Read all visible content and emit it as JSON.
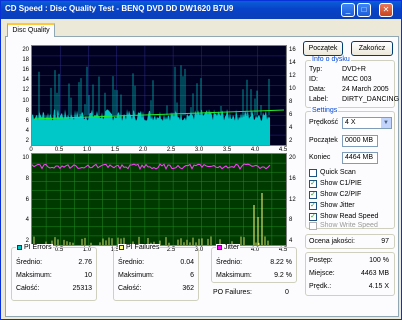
{
  "window": {
    "title": "CD Speed : Disc Quality Test - BENQ    DVD DD DW1620    B7U9",
    "minimize": "_",
    "maximize": "□",
    "close": "✕"
  },
  "tab": {
    "label": "Disc Quality"
  },
  "chart1": {
    "left_ticks": [
      "20",
      "18",
      "16",
      "14",
      "12",
      "10",
      "8",
      "6",
      "4",
      "2"
    ],
    "right_ticks": [
      "16",
      "14",
      "12",
      "10",
      "8",
      "6",
      "4",
      "2"
    ],
    "x_ticks": [
      "0",
      "0.5",
      "1.0",
      "1.5",
      "2.0",
      "2.5",
      "3.0",
      "3.5",
      "4.0",
      "4.5"
    ]
  },
  "chart2": {
    "left_ticks": [
      "10",
      "8",
      "6",
      "4",
      "2"
    ],
    "right_ticks": [
      "20",
      "16",
      "12",
      "8",
      "4"
    ],
    "x_ticks": [
      "0",
      "0.5",
      "1.0",
      "1.5",
      "2.0",
      "2.5",
      "3.0",
      "3.5",
      "4.0",
      "4.5"
    ]
  },
  "chart_data": [
    {
      "type": "area",
      "series": [
        {
          "name": "PI Errors",
          "color": "#00c8c8"
        },
        {
          "name": "PI Errors max",
          "color": "#00ff00"
        },
        {
          "name": "Read Speed",
          "color": "#00aa00"
        }
      ],
      "xlim": [
        0,
        4.5
      ],
      "ylim_left": [
        0,
        20
      ],
      "ylim_right": [
        0,
        16
      ],
      "grid": true
    },
    {
      "type": "bar",
      "series": [
        {
          "name": "PI Failures",
          "color": "#ffff80"
        },
        {
          "name": "Jitter",
          "color": "#ff00ff"
        }
      ],
      "xlim": [
        0,
        4.5
      ],
      "ylim_left": [
        0,
        10
      ],
      "ylim_right": [
        0,
        20
      ],
      "grid": true
    }
  ],
  "buttons": {
    "start": "Początek",
    "end": "Zakończ"
  },
  "info": {
    "title": "Info o dysku",
    "rows": [
      {
        "k": "Typ:",
        "v": "DVD+R"
      },
      {
        "k": "ID:",
        "v": "MCC 003"
      },
      {
        "k": "Data:",
        "v": "24 March 2005"
      },
      {
        "k": "Label:",
        "v": "DIRTY_DANCING"
      }
    ]
  },
  "settings": {
    "title": "Settings",
    "speed_label": "Prędkość",
    "speed_value": "4 X",
    "start_label": "Początek",
    "start_value": "0000 MB",
    "end_label": "Koniec",
    "end_value": "4464 MB",
    "checks": [
      {
        "label": "Quick Scan",
        "checked": false
      },
      {
        "label": "Show C1/PIE",
        "checked": true
      },
      {
        "label": "Show C2/PIF",
        "checked": true
      },
      {
        "label": "Show Jitter",
        "checked": true
      },
      {
        "label": "Show Read Speed",
        "checked": true
      },
      {
        "label": "Show Write Speed",
        "checked": false
      }
    ]
  },
  "score": {
    "label": "Ocena jakości:",
    "value": "97"
  },
  "progress": {
    "rows": [
      {
        "k": "Postęp:",
        "v": "100 %"
      },
      {
        "k": "Miejsce:",
        "v": "4463 MB"
      },
      {
        "k": "Prędk.:",
        "v": "4.15 X"
      }
    ]
  },
  "pi_errors": {
    "title": "PI Errors",
    "color": "#00c8c8",
    "rows": [
      {
        "k": "Średnio:",
        "v": "2.76"
      },
      {
        "k": "Maksimum:",
        "v": "10"
      },
      {
        "k": "Całość:",
        "v": "25313"
      }
    ]
  },
  "pi_failures": {
    "title": "PI Failures",
    "color": "#ffff80",
    "rows": [
      {
        "k": "Średnio:",
        "v": "0.04"
      },
      {
        "k": "Maksimum:",
        "v": "6"
      },
      {
        "k": "Całość:",
        "v": "362"
      }
    ]
  },
  "jitter": {
    "title": "Jitter",
    "color": "#ff00ff",
    "rows": [
      {
        "k": "Średnio:",
        "v": "8.22 %"
      },
      {
        "k": "Maksimum:",
        "v": "9.2 %"
      }
    ],
    "po_label": "PO Failures:",
    "po_value": "0"
  }
}
